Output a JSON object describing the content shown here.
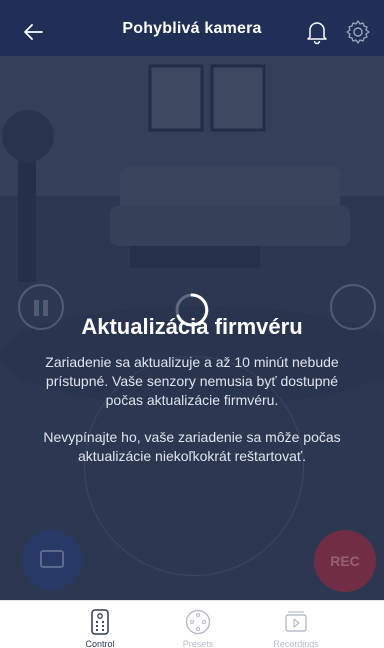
{
  "header": {
    "title": "Pohyblivá kamera",
    "icons": {
      "back": "arrow-left-icon",
      "notifications": "bell-icon",
      "settings": "gear-icon"
    }
  },
  "camera": {
    "controls": {
      "record_label": "REC"
    }
  },
  "firmware_update": {
    "title": "Aktualizácia firmvéru",
    "paragraph1": "Zariadenie sa aktualizuje a až 10 minút nebude prístupné. Vaše senzory nemusia byť dostupné počas aktualizácie firmvéru.",
    "paragraph2": "Nevypínajte ho, vaše zariadenie sa môže počas aktualizácie niekoľkokrát reštartovať."
  },
  "tabs": [
    {
      "label": "Control",
      "icon": "remote-icon",
      "active": true
    },
    {
      "label": "Presets",
      "icon": "presets-dial-icon",
      "active": false
    },
    {
      "label": "Recordings",
      "icon": "recordings-icon",
      "active": false
    }
  ],
  "colors": {
    "header_bg": "#1f2f55",
    "overlay": "#16213e",
    "active_tab": "#2e3a55",
    "inactive_tab": "#b8bdc9",
    "record": "#c0283c"
  }
}
